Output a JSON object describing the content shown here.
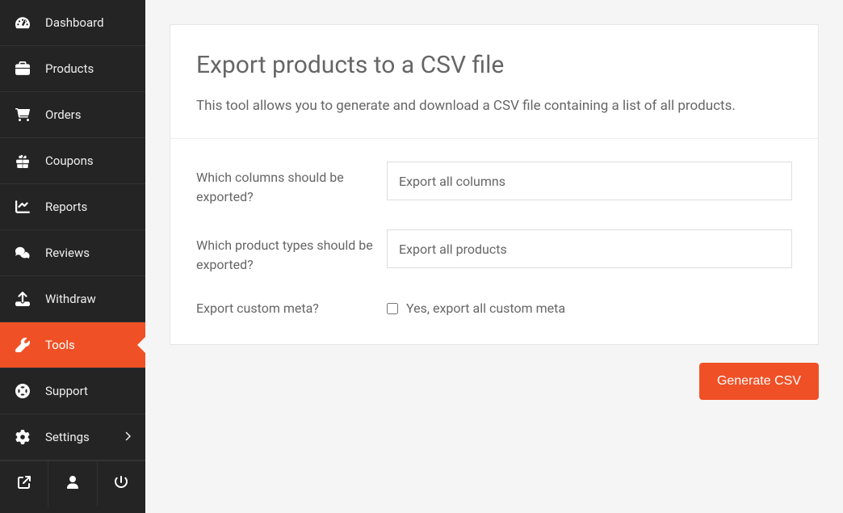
{
  "sidebar": {
    "items": [
      {
        "id": "dashboard",
        "label": "Dashboard",
        "icon": "gauge-icon",
        "active": false
      },
      {
        "id": "products",
        "label": "Products",
        "icon": "briefcase-icon",
        "active": false
      },
      {
        "id": "orders",
        "label": "Orders",
        "icon": "cart-icon",
        "active": false
      },
      {
        "id": "coupons",
        "label": "Coupons",
        "icon": "gift-icon",
        "active": false
      },
      {
        "id": "reports",
        "label": "Reports",
        "icon": "chart-line-icon",
        "active": false
      },
      {
        "id": "reviews",
        "label": "Reviews",
        "icon": "comments-icon",
        "active": false
      },
      {
        "id": "withdraw",
        "label": "Withdraw",
        "icon": "upload-icon",
        "active": false
      },
      {
        "id": "tools",
        "label": "Tools",
        "icon": "wrench-icon",
        "active": true
      },
      {
        "id": "support",
        "label": "Support",
        "icon": "life-ring-icon",
        "active": false
      },
      {
        "id": "settings",
        "label": "Settings",
        "icon": "gear-icon",
        "active": false,
        "has_submenu": true
      }
    ],
    "bottom": [
      {
        "id": "external",
        "icon": "external-link-icon"
      },
      {
        "id": "profile",
        "icon": "user-icon"
      },
      {
        "id": "logout",
        "icon": "power-icon"
      }
    ]
  },
  "page": {
    "title": "Export products to a CSV file",
    "description": "This tool allows you to generate and download a CSV file containing a list of all products.",
    "fields": {
      "columns": {
        "label": "Which columns should be exported?",
        "value": "Export all columns"
      },
      "types": {
        "label": "Which product types should be exported?",
        "value": "Export all products"
      },
      "meta": {
        "label": "Export custom meta?",
        "checkbox_label": "Yes, export all custom meta",
        "checked": false
      }
    },
    "submit_label": "Generate CSV"
  },
  "colors": {
    "accent": "#f05025"
  }
}
